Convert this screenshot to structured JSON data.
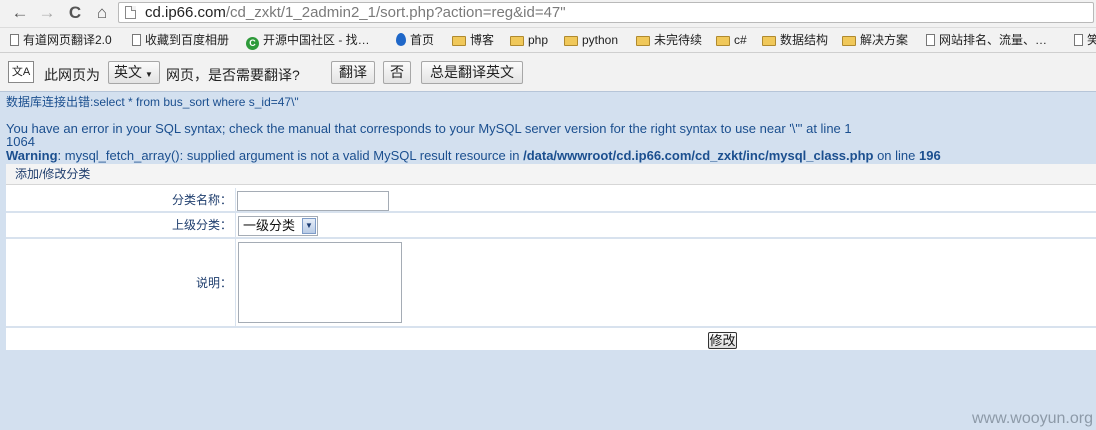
{
  "browser": {
    "url_host": "cd.ip66.com",
    "url_rest": "/cd_zxkt/1_2admin2_1/sort.php?action=reg&id=47\"",
    "nav": {
      "back": "←",
      "forward": "→",
      "reload": "C",
      "home": "⌂"
    },
    "bookmarks": [
      {
        "label": "有道网页翻译2.0",
        "icon": "page-icon"
      },
      {
        "label": "收藏到百度相册",
        "icon": "page-icon"
      },
      {
        "label": "开源中国社区 - 找…",
        "icon": "green-c-icon"
      },
      {
        "label": "首页",
        "icon": "blue-drop-icon"
      },
      {
        "label": "博客",
        "icon": "folder-icon"
      },
      {
        "label": "php",
        "icon": "folder-icon"
      },
      {
        "label": "python",
        "icon": "folder-icon"
      },
      {
        "label": "未完待续",
        "icon": "folder-icon"
      },
      {
        "label": "c#",
        "icon": "folder-icon"
      },
      {
        "label": "数据结构",
        "icon": "folder-icon"
      },
      {
        "label": "解决方案",
        "icon": "folder-icon"
      },
      {
        "label": "网站排名、流量、…",
        "icon": "page-icon"
      },
      {
        "label": "笑",
        "icon": "page-icon"
      }
    ]
  },
  "translate": {
    "icon_text": "文A",
    "prefix": "此网页为",
    "language": "英文",
    "question": "网页，是否需要翻译?",
    "translate_btn": "翻译",
    "no_btn": "否",
    "always_btn": "总是翻译英文"
  },
  "errors": {
    "db_error": "数据库连接出错:select * from bus_sort where s_id=47\\\"",
    "sql_error": "You have an error in your SQL syntax; check the manual that corresponds to your MySQL server version for the right syntax to use near '\\\"' at line 1",
    "code": "1064",
    "warning_label": "Warning",
    "warning_msg": ": mysql_fetch_array(): supplied argument is not a valid MySQL result resource in ",
    "warning_path": "/data/wwwroot/cd.ip66.com/cd_zxkt/inc/mysql_class.php",
    "warning_on": " on line ",
    "warning_line": "196"
  },
  "form": {
    "title": "添加/修改分类",
    "name_label": "分类名称：",
    "name_value": "",
    "parent_label": "上级分类：",
    "parent_selected": "一级分类",
    "desc_label": "说明：",
    "desc_value": "",
    "submit": "修改"
  },
  "watermark": "www.wooyun.org"
}
